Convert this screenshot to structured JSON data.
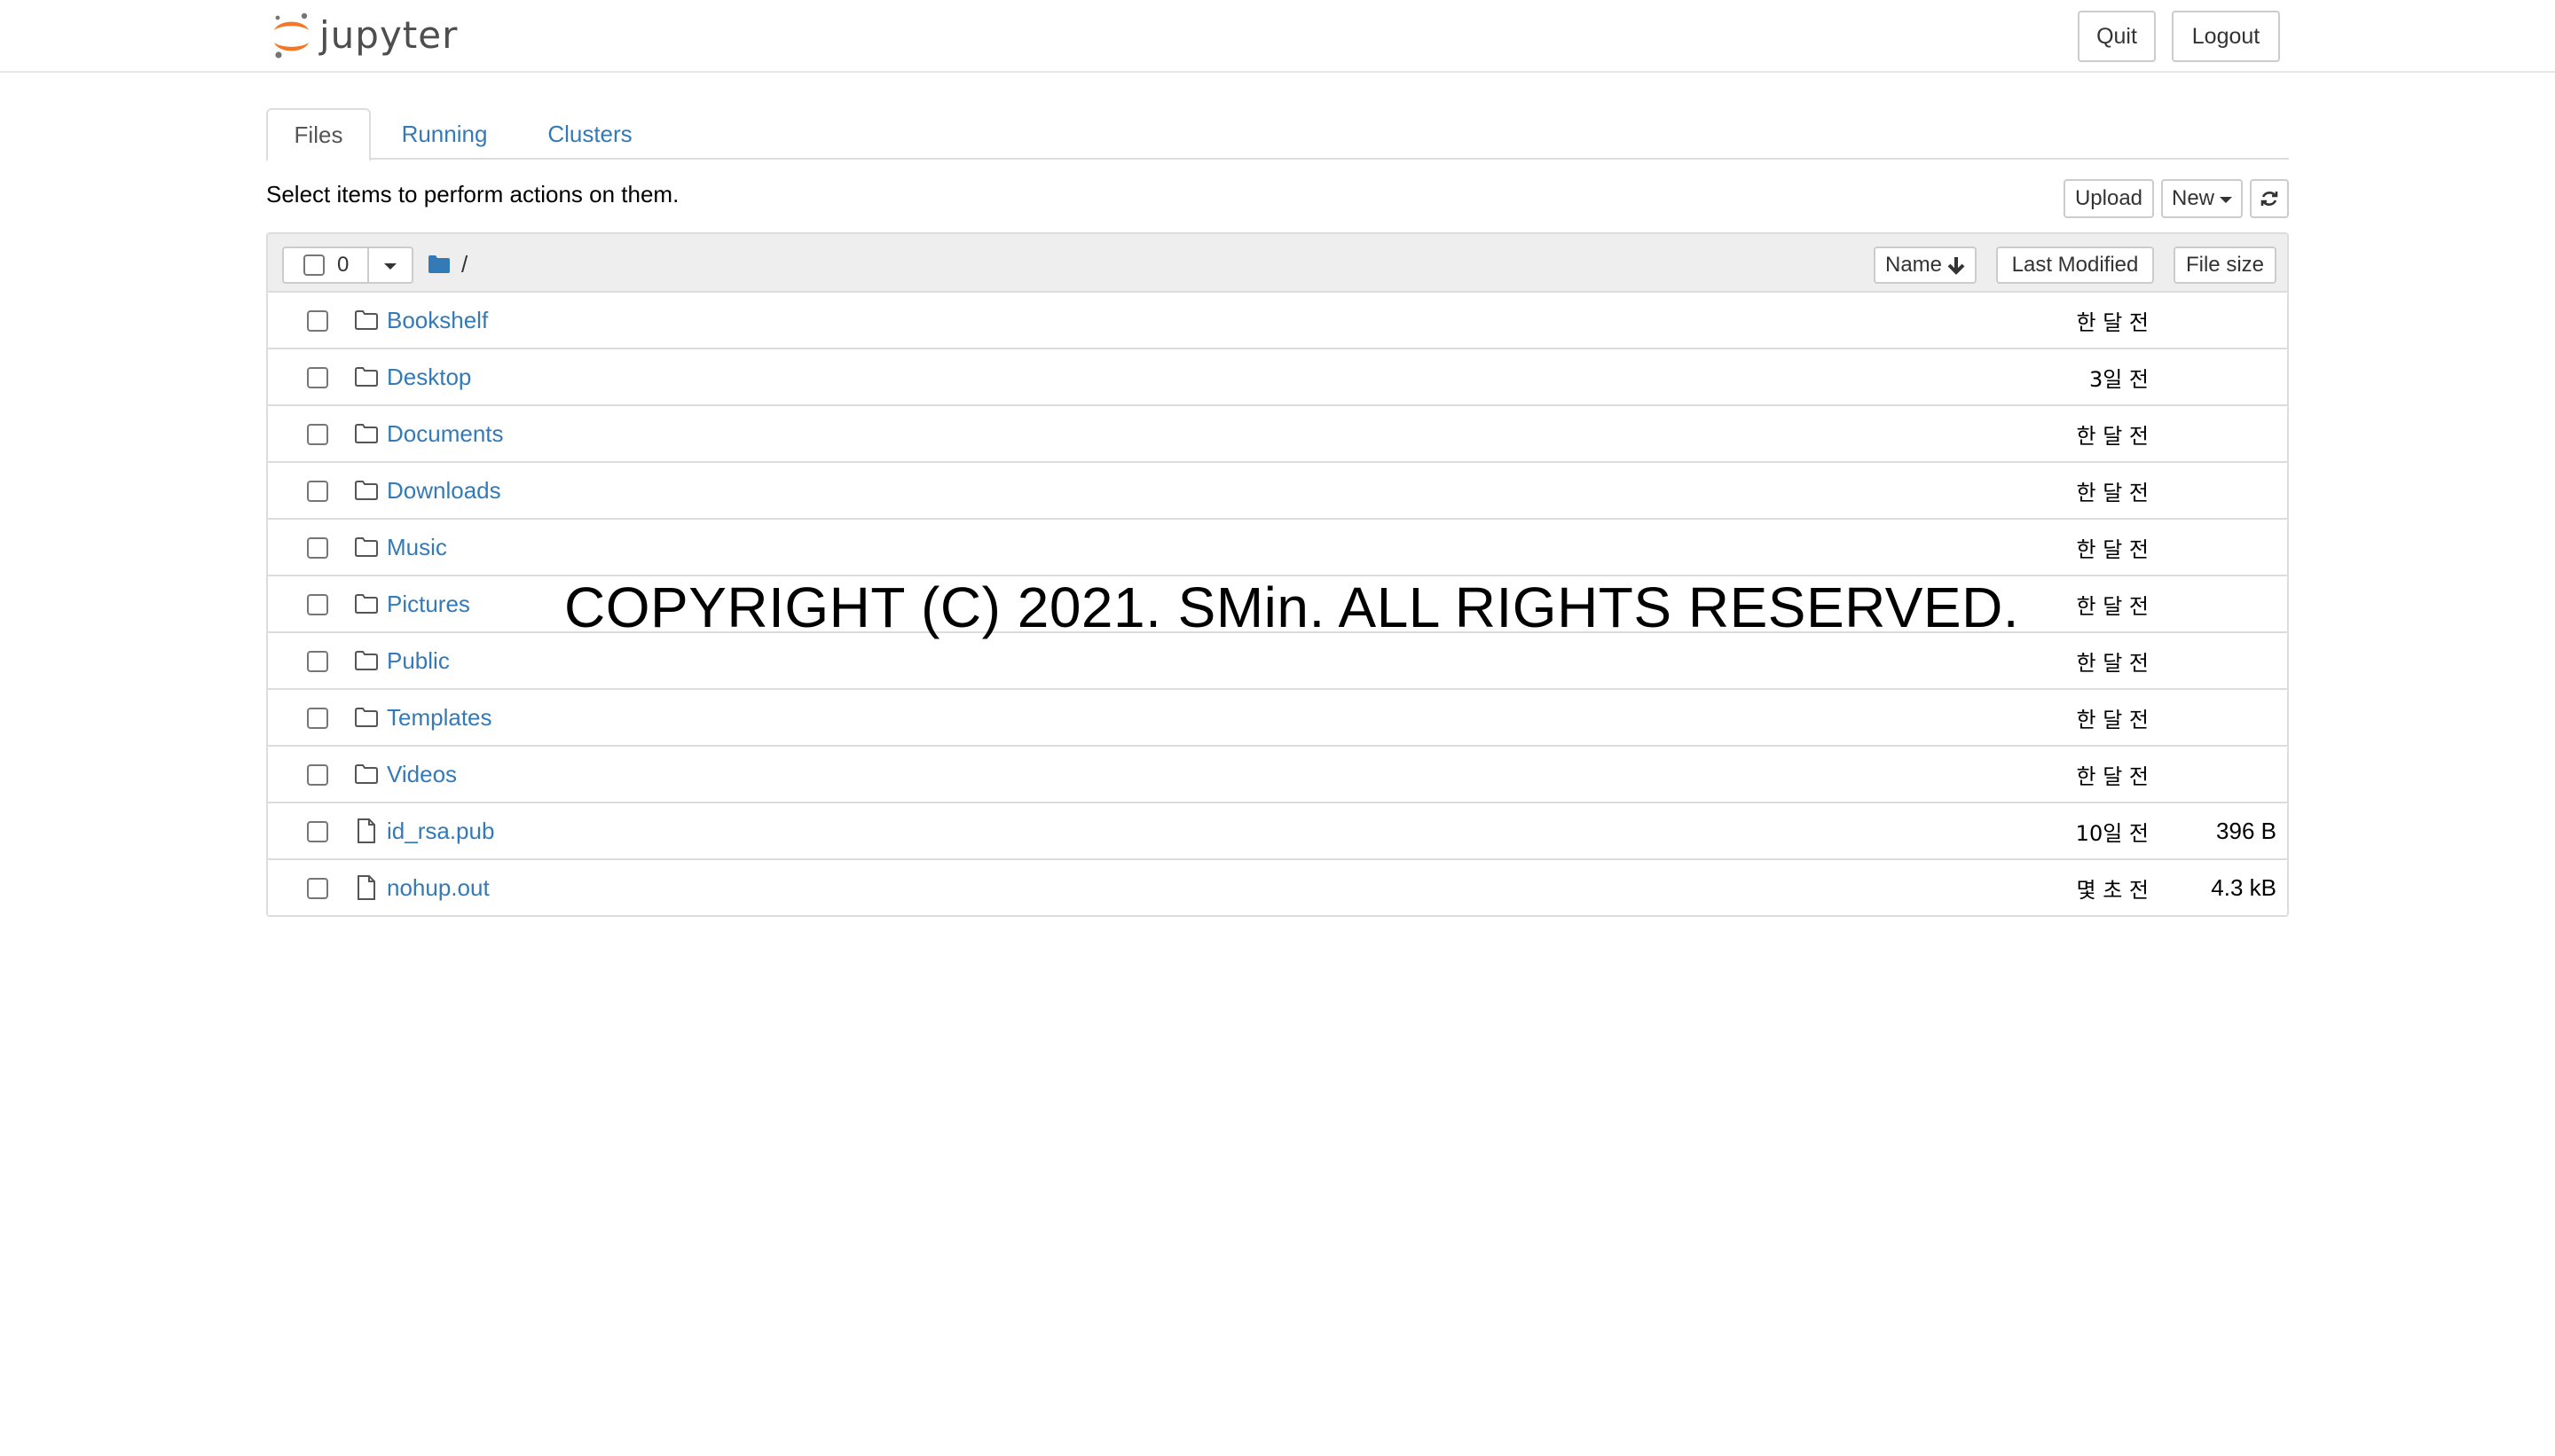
{
  "header": {
    "logo_text": "jupyter",
    "quit_label": "Quit",
    "logout_label": "Logout"
  },
  "tabs": [
    {
      "label": "Files",
      "active": true
    },
    {
      "label": "Running",
      "active": false
    },
    {
      "label": "Clusters",
      "active": false
    }
  ],
  "toolbar": {
    "instructions": "Select items to perform actions on them.",
    "upload_label": "Upload",
    "new_label": "New",
    "refresh_icon": "refresh-icon"
  },
  "list_header": {
    "selected_count": "0",
    "path": "/",
    "sort_name_label": "Name",
    "sort_modified_label": "Last Modified",
    "sort_size_label": "File size"
  },
  "items": [
    {
      "name": "Bookshelf",
      "type": "folder",
      "modified": "한 달 전",
      "size": ""
    },
    {
      "name": "Desktop",
      "type": "folder",
      "modified": "3일 전",
      "size": ""
    },
    {
      "name": "Documents",
      "type": "folder",
      "modified": "한 달 전",
      "size": ""
    },
    {
      "name": "Downloads",
      "type": "folder",
      "modified": "한 달 전",
      "size": ""
    },
    {
      "name": "Music",
      "type": "folder",
      "modified": "한 달 전",
      "size": ""
    },
    {
      "name": "Pictures",
      "type": "folder",
      "modified": "한 달 전",
      "size": ""
    },
    {
      "name": "Public",
      "type": "folder",
      "modified": "한 달 전",
      "size": ""
    },
    {
      "name": "Templates",
      "type": "folder",
      "modified": "한 달 전",
      "size": ""
    },
    {
      "name": "Videos",
      "type": "folder",
      "modified": "한 달 전",
      "size": ""
    },
    {
      "name": "id_rsa.pub",
      "type": "file",
      "modified": "10일 전",
      "size": "396 B"
    },
    {
      "name": "nohup.out",
      "type": "file",
      "modified": "몇 초 전",
      "size": "4.3 kB"
    }
  ],
  "watermark": "COPYRIGHT (C) 2021. SMin. ALL RIGHTS RESERVED.",
  "colors": {
    "link": "#337ab7",
    "logo_orange": "#f37726",
    "logo_gray": "#767677",
    "folder_icon": "#337ab7"
  }
}
